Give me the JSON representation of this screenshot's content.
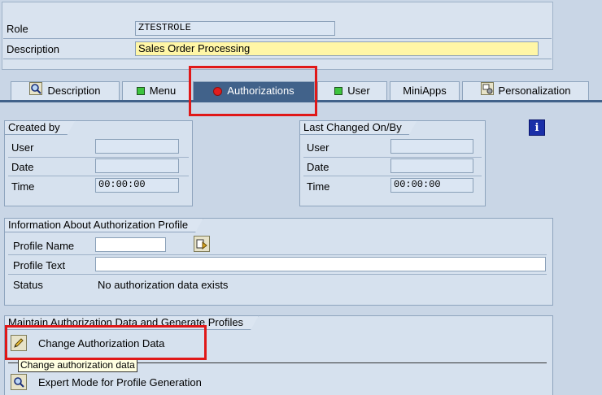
{
  "header": {
    "role_label": "Role",
    "role_value": "ZTESTROLE",
    "description_label": "Description",
    "description_value": "Sales Order Processing"
  },
  "tabs": [
    {
      "label": "Description",
      "icon": "magnifier-icon"
    },
    {
      "label": "Menu",
      "icon": "green-square-icon"
    },
    {
      "label": "Authorizations",
      "icon": "red-status-icon",
      "active": true
    },
    {
      "label": "User",
      "icon": "green-square-icon"
    },
    {
      "label": "MiniApps",
      "icon": ""
    },
    {
      "label": "Personalization",
      "icon": "personalization-icon"
    }
  ],
  "created_by": {
    "title": "Created by",
    "user_label": "User",
    "user_value": "",
    "date_label": "Date",
    "date_value": "",
    "time_label": "Time",
    "time_value": "00:00:00"
  },
  "last_changed": {
    "title": "Last Changed On/By",
    "user_label": "User",
    "user_value": "",
    "date_label": "Date",
    "date_value": "",
    "time_label": "Time",
    "time_value": "00:00:00"
  },
  "info_button": {
    "label": "i"
  },
  "profile": {
    "title": "Information About Authorization Profile",
    "name_label": "Profile Name",
    "name_value": "",
    "text_label": "Profile Text",
    "text_value": "",
    "status_label": "Status",
    "status_value": "No authorization data exists"
  },
  "maintain": {
    "title": "Maintain Authorization Data and Generate Profiles",
    "change_label": "Change Authorization Data",
    "tooltip": "Change authorization data",
    "expert_label": "Expert Mode for Profile Generation"
  },
  "colors": {
    "highlight_red": "#e01818",
    "active_tab": "#41628a",
    "yellow_field": "#fff6a6"
  }
}
